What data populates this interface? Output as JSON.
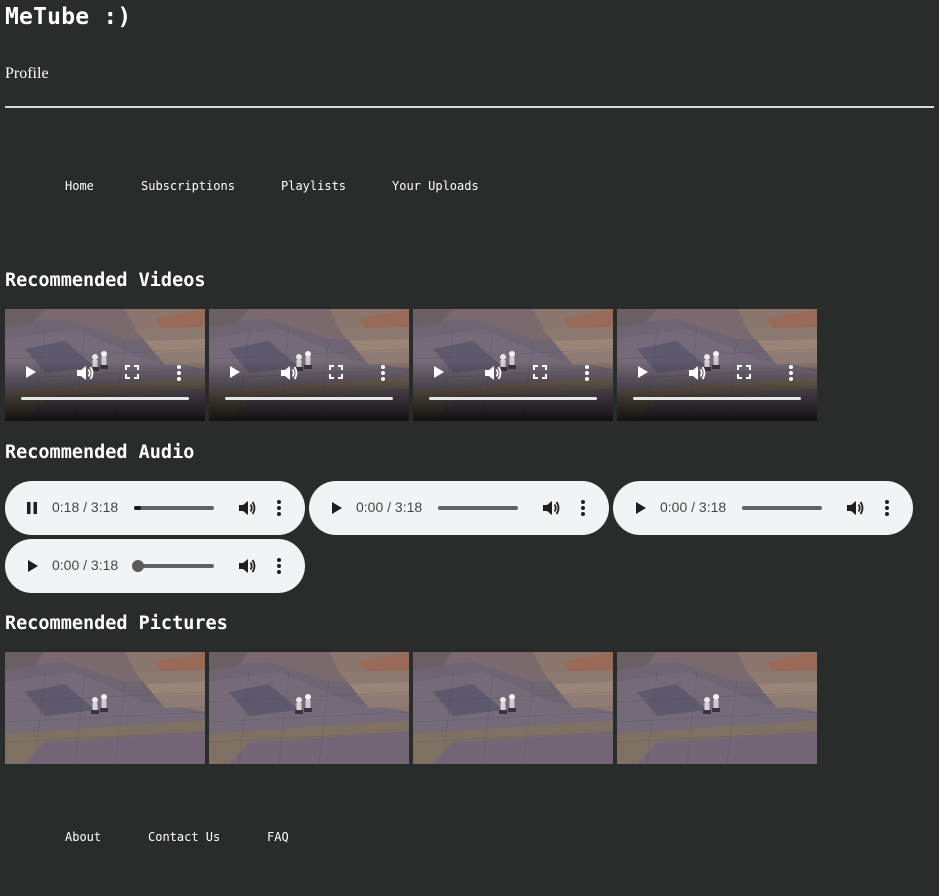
{
  "site": {
    "title": "MeTube :)",
    "profile_link": "Profile"
  },
  "nav": {
    "items": [
      "Home",
      "Subscriptions",
      "Playlists",
      "Your Uploads"
    ]
  },
  "sections": {
    "videos_title": "Recommended Videos",
    "audio_title": "Recommended Audio",
    "pictures_title": "Recommended Pictures"
  },
  "videos": [
    {
      "state": "paused",
      "icons": [
        "play-icon",
        "volume-icon",
        "fullscreen-icon",
        "more-options-icon"
      ]
    },
    {
      "state": "paused",
      "icons": [
        "play-icon",
        "volume-icon",
        "fullscreen-icon",
        "more-options-icon"
      ]
    },
    {
      "state": "paused",
      "icons": [
        "play-icon",
        "volume-icon",
        "fullscreen-icon",
        "more-options-icon"
      ]
    },
    {
      "state": "paused",
      "icons": [
        "play-icon",
        "volume-icon",
        "fullscreen-icon",
        "more-options-icon"
      ]
    }
  ],
  "audio": [
    {
      "state": "playing",
      "time": "0:18 / 3:18",
      "progress": 0.09
    },
    {
      "state": "paused",
      "time": "0:00 / 3:18",
      "progress": 0
    },
    {
      "state": "paused",
      "time": "0:00 / 3:18",
      "progress": 0
    },
    {
      "state": "paused",
      "time": "0:00 / 3:18",
      "progress": 0,
      "show_thumb": true
    }
  ],
  "pictures": [
    {
      "icon": "picture-thumbnail"
    },
    {
      "icon": "picture-thumbnail"
    },
    {
      "icon": "picture-thumbnail"
    },
    {
      "icon": "picture-thumbnail"
    }
  ],
  "footer": {
    "items": [
      "About",
      "Contact Us",
      "FAQ"
    ]
  },
  "colors": {
    "background": "#2a2b2b",
    "text": "#ffffff",
    "audio_player_bg": "#f1f3f4",
    "audio_text": "#474747"
  }
}
